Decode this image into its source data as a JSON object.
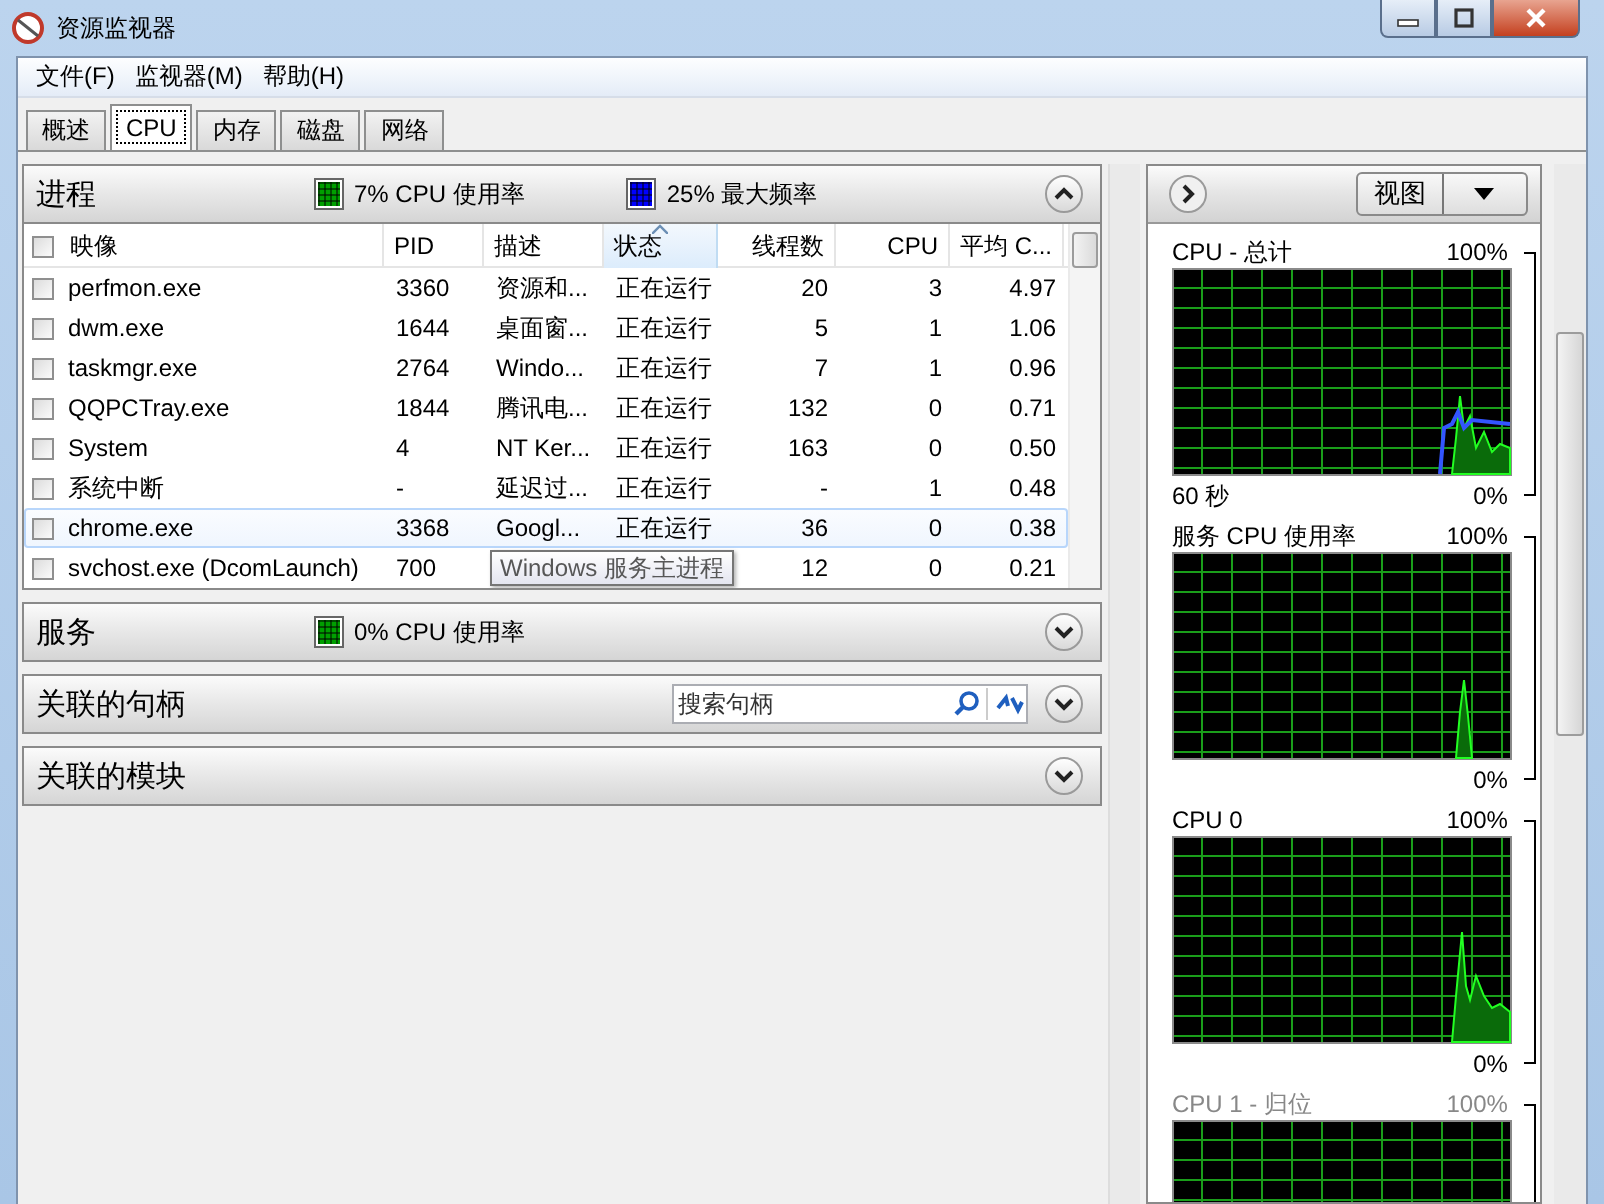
{
  "window": {
    "title": "资源监视器"
  },
  "menu": [
    {
      "label": "文件(F)"
    },
    {
      "label": "监视器(M)"
    },
    {
      "label": "帮助(H)"
    }
  ],
  "tabs": [
    {
      "label": "概述",
      "selected": false
    },
    {
      "label": "CPU",
      "selected": true
    },
    {
      "label": "内存",
      "selected": false
    },
    {
      "label": "磁盘",
      "selected": false
    },
    {
      "label": "网络",
      "selected": false
    }
  ],
  "sections": [
    {
      "title": "进程",
      "expanded": true,
      "indicators": [
        {
          "text": "7% CPU 使用率",
          "color": "#00a000"
        },
        {
          "text": "25% 最大频率",
          "color": "#0000ff"
        }
      ],
      "table": {
        "header_checked": false,
        "columns": [
          {
            "label": "映像",
            "sorted": false
          },
          {
            "label": "PID",
            "sorted": false
          },
          {
            "label": "描述",
            "sorted": false
          },
          {
            "label": "状态",
            "sorted": true
          },
          {
            "label": "线程数",
            "sorted": false
          },
          {
            "label": "CPU",
            "sorted": false
          },
          {
            "label": "平均 C...",
            "sorted": false
          }
        ],
        "rows": [
          {
            "checked": false,
            "selected": false,
            "cells": [
              "perfmon.exe",
              "3360",
              "资源和...",
              "正在运行",
              "20",
              "3",
              "4.97"
            ]
          },
          {
            "checked": false,
            "selected": false,
            "cells": [
              "dwm.exe",
              "1644",
              "桌面窗...",
              "正在运行",
              "5",
              "1",
              "1.06"
            ]
          },
          {
            "checked": false,
            "selected": false,
            "cells": [
              "taskmgr.exe",
              "2764",
              "Windo...",
              "正在运行",
              "7",
              "1",
              "0.96"
            ]
          },
          {
            "checked": false,
            "selected": false,
            "cells": [
              "QQPCTray.exe",
              "1844",
              "腾讯电...",
              "正在运行",
              "132",
              "0",
              "0.71"
            ]
          },
          {
            "checked": false,
            "selected": false,
            "cells": [
              "System",
              "4",
              "NT Ker...",
              "正在运行",
              "163",
              "0",
              "0.50"
            ]
          },
          {
            "checked": false,
            "selected": false,
            "cells": [
              "系统中断",
              "-",
              "延迟过...",
              "正在运行",
              "-",
              "1",
              "0.48"
            ]
          },
          {
            "checked": false,
            "selected": true,
            "cells": [
              "chrome.exe",
              "3368",
              "Googl...",
              "正在运行",
              "36",
              "0",
              "0.38"
            ]
          },
          {
            "checked": false,
            "selected": false,
            "cells": [
              "svchost.exe (DcomLaunch)",
              "700",
              null,
              null,
              "12",
              "0",
              "0.21"
            ]
          }
        ]
      }
    },
    {
      "title": "服务",
      "expanded": false,
      "indicators": [
        {
          "text": "0% CPU 使用率",
          "color": "#00a000"
        }
      ]
    },
    {
      "title": "关联的句柄",
      "expanded": false,
      "search": {
        "placeholder": "搜索句柄"
      }
    },
    {
      "title": "关联的模块",
      "expanded": false
    }
  ],
  "tooltip": {
    "text": "Windows 服务主进程"
  },
  "right_panel": {
    "view_button": "视图",
    "graphs": [
      {
        "label": "CPU - 总计",
        "max": "100%",
        "min": "0%",
        "time": "60 秒",
        "dimmed": false
      },
      {
        "label": "服务 CPU 使用率",
        "max": "100%",
        "min": "0%",
        "dimmed": false
      },
      {
        "label": "CPU 0",
        "max": "100%",
        "min": "0%",
        "dimmed": false
      },
      {
        "label": "CPU 1 - 归位",
        "max": "100%",
        "dimmed": true
      }
    ]
  }
}
